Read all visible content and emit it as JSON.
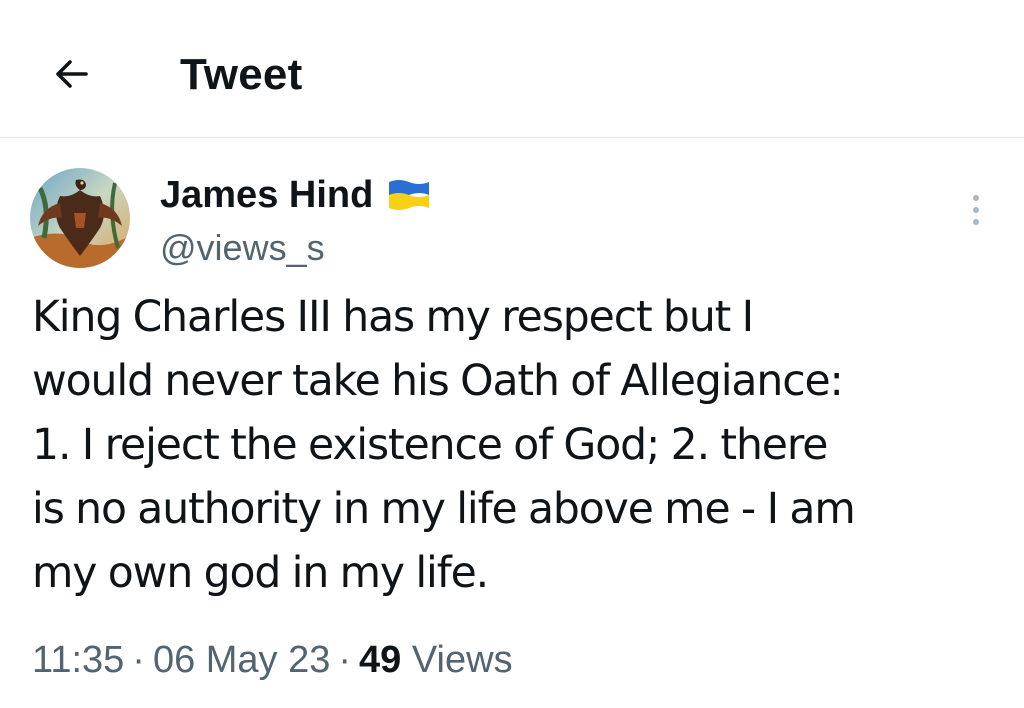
{
  "header": {
    "back_icon": "arrow-left-icon",
    "title": "Tweet"
  },
  "tweet": {
    "author": {
      "name": "James Hind",
      "handle": "@views_s",
      "flag_icon": "ukraine-flag-icon",
      "flag_colors": [
        "#2a6fd1",
        "#f7d117"
      ],
      "avatar": "eagle-avatar"
    },
    "text_lines": [
      "King Charles III has my respect but I",
      "would never take his Oath of Allegiance:",
      "1. I reject the existence of God; 2. there",
      "is no authority in my life above me - I am",
      "my own god in my life."
    ],
    "time": "11:35",
    "separator": "·",
    "date": "06 May 23",
    "views_count": "49",
    "views_label": "Views",
    "more_icon": "more-vertical-icon"
  },
  "colors": {
    "text": "#0f1419",
    "secondary": "#536471",
    "divider": "#e6e9eb"
  }
}
